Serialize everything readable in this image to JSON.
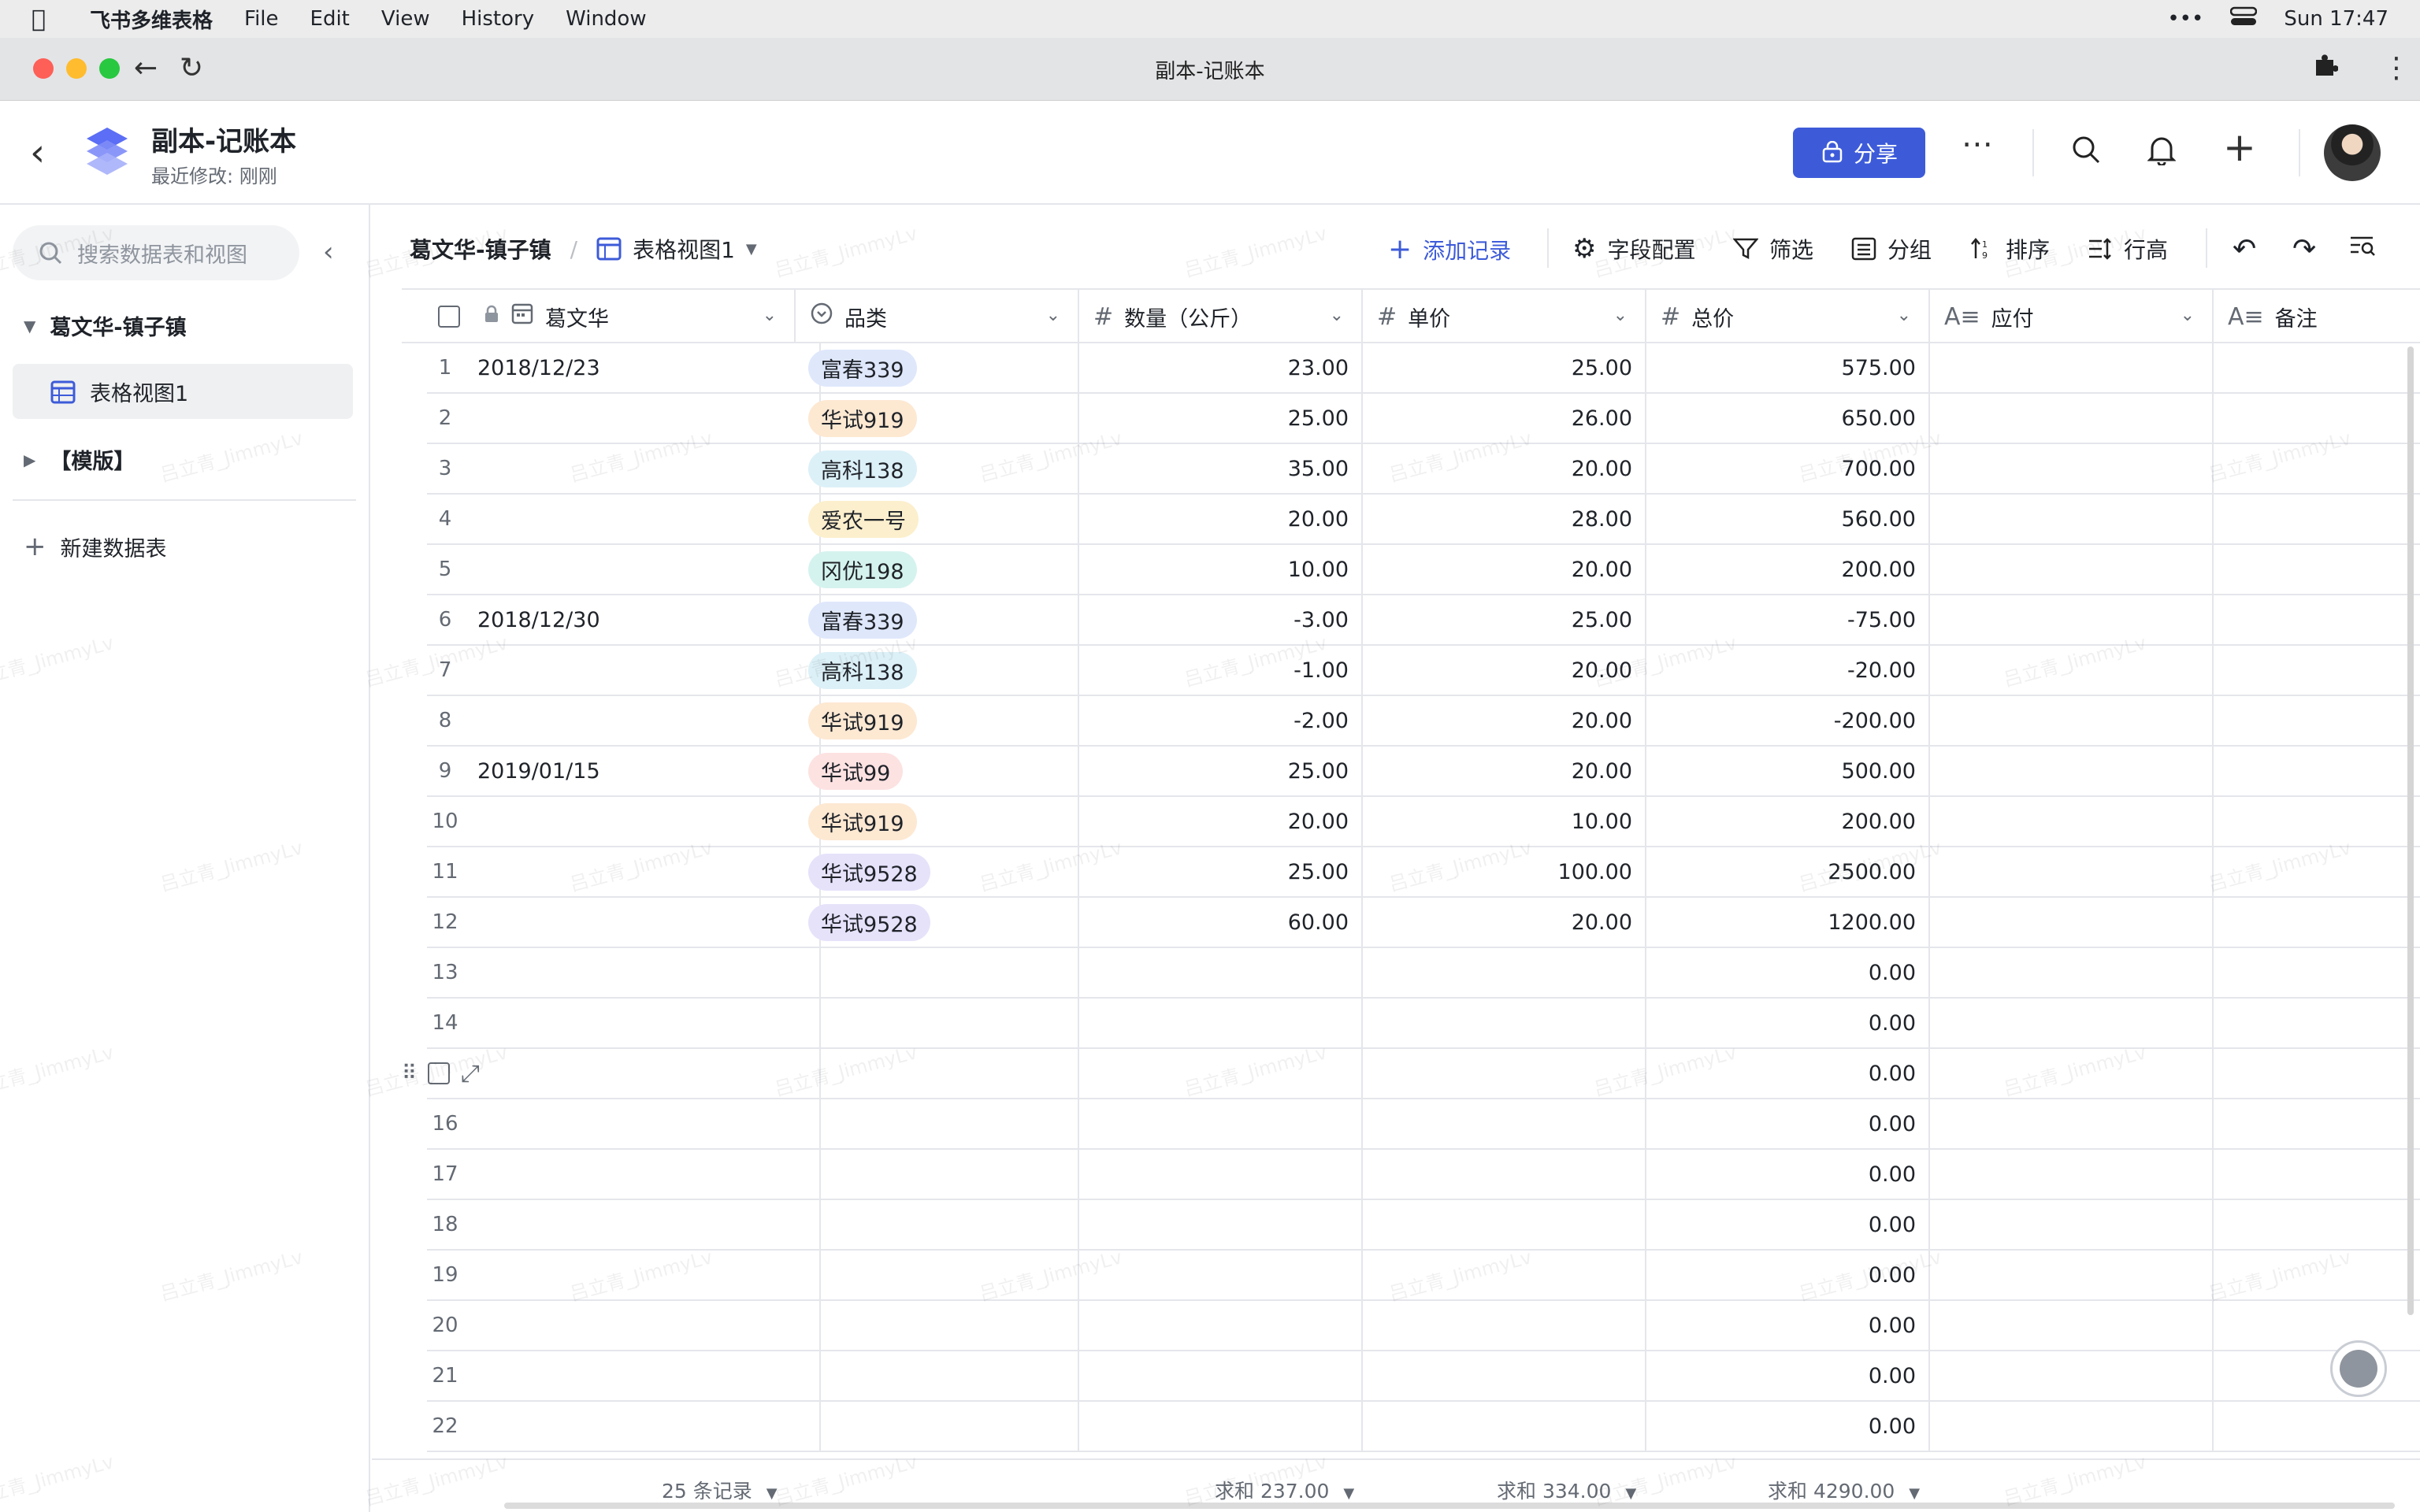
{
  "menubar": {
    "app_name": "飞书多维表格",
    "items": [
      "File",
      "Edit",
      "View",
      "History",
      "Window"
    ],
    "more": "•••",
    "clock": "Sun 17:47"
  },
  "window": {
    "title": "副本-记账本"
  },
  "header": {
    "doc_title": "副本-记账本",
    "doc_subtitle": "最近修改: 刚刚",
    "share_label": "分享"
  },
  "sidebar": {
    "search_placeholder": "搜索数据表和视图",
    "table_name": "葛文华-镇子镇",
    "view_name": "表格视图1",
    "template_name": "【模版】",
    "new_table": "新建数据表"
  },
  "toolbar": {
    "breadcrumb_table": "葛文华-镇子镇",
    "breadcrumb_sep": "/",
    "breadcrumb_view": "表格视图1",
    "add_record": "添加记录",
    "field_config": "字段配置",
    "filter": "筛选",
    "group": "分组",
    "sort": "排序",
    "row_height": "行高"
  },
  "columns": [
    "葛文华",
    "品类",
    "数量（公斤）",
    "单价",
    "总价",
    "应付",
    "备注"
  ],
  "rows": [
    {
      "no": "1",
      "date": "2018/12/23",
      "cat": "富春339",
      "qty": "23.00",
      "price": "25.00",
      "total": "575.00"
    },
    {
      "no": "2",
      "date": "",
      "cat": "华试919",
      "qty": "25.00",
      "price": "26.00",
      "total": "650.00"
    },
    {
      "no": "3",
      "date": "",
      "cat": "高科138",
      "qty": "35.00",
      "price": "20.00",
      "total": "700.00"
    },
    {
      "no": "4",
      "date": "",
      "cat": "爱农一号",
      "qty": "20.00",
      "price": "28.00",
      "total": "560.00"
    },
    {
      "no": "5",
      "date": "",
      "cat": "冈优198",
      "qty": "10.00",
      "price": "20.00",
      "total": "200.00"
    },
    {
      "no": "6",
      "date": "2018/12/30",
      "cat": "富春339",
      "qty": "-3.00",
      "price": "25.00",
      "total": "-75.00"
    },
    {
      "no": "7",
      "date": "",
      "cat": "高科138",
      "qty": "-1.00",
      "price": "20.00",
      "total": "-20.00"
    },
    {
      "no": "8",
      "date": "",
      "cat": "华试919",
      "qty": "-2.00",
      "price": "20.00",
      "total": "-200.00"
    },
    {
      "no": "9",
      "date": "2019/01/15",
      "cat": "华试99",
      "qty": "25.00",
      "price": "20.00",
      "total": "500.00"
    },
    {
      "no": "10",
      "date": "",
      "cat": "华试919",
      "qty": "20.00",
      "price": "10.00",
      "total": "200.00"
    },
    {
      "no": "11",
      "date": "",
      "cat": "华试9528",
      "qty": "25.00",
      "price": "100.00",
      "total": "2500.00"
    },
    {
      "no": "12",
      "date": "",
      "cat": "华试9528",
      "qty": "60.00",
      "price": "20.00",
      "total": "1200.00"
    },
    {
      "no": "13",
      "date": "",
      "cat": "",
      "qty": "",
      "price": "",
      "total": "0.00"
    },
    {
      "no": "14",
      "date": "",
      "cat": "",
      "qty": "",
      "price": "",
      "total": "0.00"
    },
    {
      "no": "",
      "date": "",
      "cat": "",
      "qty": "",
      "price": "",
      "total": "0.00"
    },
    {
      "no": "16",
      "date": "",
      "cat": "",
      "qty": "",
      "price": "",
      "total": "0.00"
    },
    {
      "no": "17",
      "date": "",
      "cat": "",
      "qty": "",
      "price": "",
      "total": "0.00"
    },
    {
      "no": "18",
      "date": "",
      "cat": "",
      "qty": "",
      "price": "",
      "total": "0.00"
    },
    {
      "no": "19",
      "date": "",
      "cat": "",
      "qty": "",
      "price": "",
      "total": "0.00"
    },
    {
      "no": "20",
      "date": "",
      "cat": "",
      "qty": "",
      "price": "",
      "total": "0.00"
    },
    {
      "no": "21",
      "date": "",
      "cat": "",
      "qty": "",
      "price": "",
      "total": "0.00"
    },
    {
      "no": "22",
      "date": "",
      "cat": "",
      "qty": "",
      "price": "",
      "total": "0.00"
    }
  ],
  "tag_colors": {
    "富春339": "#dfe7fb",
    "华试919": "#fde8d2",
    "高科138": "#dcf0f7",
    "爱农一号": "#fcefcd",
    "冈优198": "#d5f3ee",
    "华试99": "#fde2e2",
    "华试9528": "#e6e2fa"
  },
  "footer": {
    "records": "25 条记录",
    "sum_qty": "求和 237.00",
    "sum_price": "求和 334.00",
    "sum_total": "求和 4290.00"
  },
  "colors": {
    "accent": "#3d5bd9",
    "border": "#e5e6eb"
  },
  "watermark_text": "吕立青_JimmyLv"
}
